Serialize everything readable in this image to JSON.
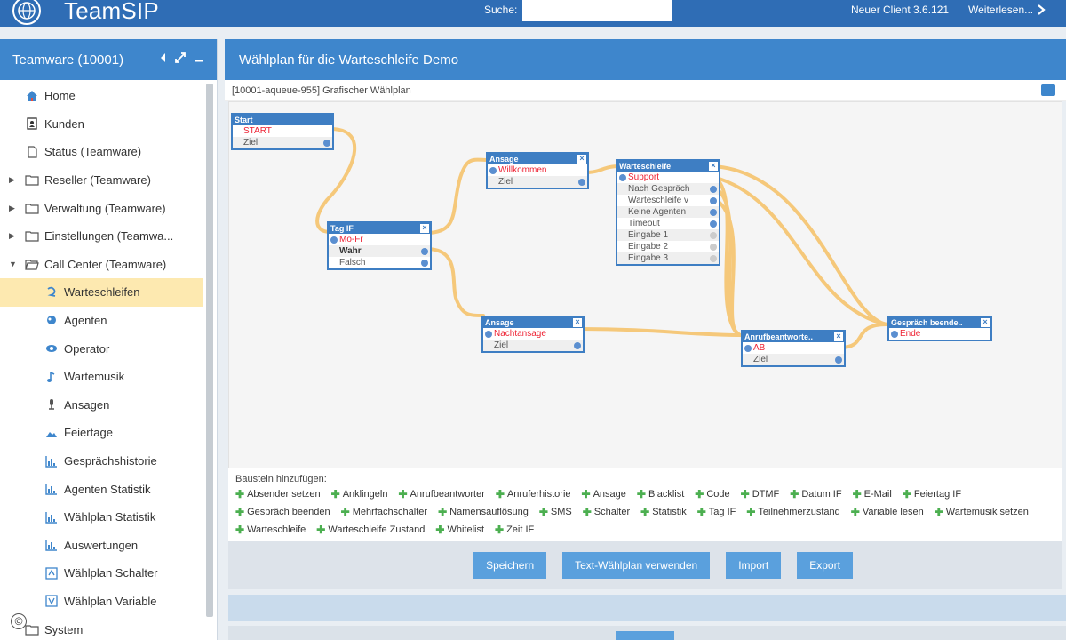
{
  "app": {
    "name": "TeamSIP",
    "search_label": "Suche:",
    "search_value": "",
    "client_version": "Neuer Client 3.6.121",
    "read_more": "Weiterlesen..."
  },
  "sidebar": {
    "title": "Teamware (10001)",
    "items": [
      {
        "label": "Home",
        "icon": "home-icon"
      },
      {
        "label": "Kunden",
        "icon": "contacts-icon"
      },
      {
        "label": "Status (Teamware)",
        "icon": "document-icon"
      },
      {
        "label": "Reseller (Teamware)",
        "icon": "folder-icon"
      },
      {
        "label": "Verwaltung (Teamware)",
        "icon": "folder-icon"
      },
      {
        "label": "Einstellungen (Teamwa...",
        "icon": "folder-icon"
      },
      {
        "label": "Call Center (Teamware)",
        "icon": "folder-open-icon"
      },
      {
        "label": "Warteschleifen",
        "icon": "queue-icon"
      },
      {
        "label": "Agenten",
        "icon": "agent-icon"
      },
      {
        "label": "Operator",
        "icon": "operator-icon"
      },
      {
        "label": "Wartemusik",
        "icon": "music-note-icon"
      },
      {
        "label": "Ansagen",
        "icon": "microphone-icon"
      },
      {
        "label": "Feiertage",
        "icon": "landscape-icon"
      },
      {
        "label": "Gesprächshistorie",
        "icon": "bar-chart-icon"
      },
      {
        "label": "Agenten Statistik",
        "icon": "bar-chart-icon"
      },
      {
        "label": "Wählplan Statistik",
        "icon": "bar-chart-icon"
      },
      {
        "label": "Auswertungen",
        "icon": "bar-chart-icon"
      },
      {
        "label": "Wählplan Schalter",
        "icon": "switch-icon"
      },
      {
        "label": "Wählplan Variable",
        "icon": "variable-icon"
      },
      {
        "label": "System",
        "icon": "folder-icon"
      }
    ]
  },
  "main": {
    "title": "Wählplan für die Warteschleife Demo",
    "subtitle": "[10001-aqueue-955] Grafischer Wählplan"
  },
  "nodes": {
    "start": {
      "title": "Start",
      "rows": [
        "START",
        "Ziel"
      ]
    },
    "tagif": {
      "title": "Tag IF",
      "rows": [
        "Mo-Fr",
        "Wahr",
        "Falsch"
      ]
    },
    "ansage1": {
      "title": "Ansage",
      "rows": [
        "Willkommen",
        "Ziel"
      ]
    },
    "ansage2": {
      "title": "Ansage",
      "rows": [
        "Nachtansage",
        "Ziel"
      ]
    },
    "warteschleife": {
      "title": "Warteschleife",
      "rows": [
        "Support",
        "Nach Gespräch",
        "Warteschleife v",
        "Keine Agenten",
        "Timeout",
        "Eingabe 1",
        "Eingabe 2",
        "Eingabe 3"
      ]
    },
    "anrufbeantworter": {
      "title": "Anrufbeantworte..",
      "rows": [
        "AB",
        "Ziel"
      ]
    },
    "gespraech": {
      "title": "Gespräch beende..",
      "rows": [
        "Ende"
      ]
    }
  },
  "palette": {
    "title": "Baustein hinzufügen:",
    "items": [
      "Absender setzen",
      "Anklingeln",
      "Anrufbeantworter",
      "Anruferhistorie",
      "Ansage",
      "Blacklist",
      "Code",
      "DTMF",
      "Datum IF",
      "E-Mail",
      "Feiertag IF",
      "Gespräch beenden",
      "Mehrfachschalter",
      "Namensauflösung",
      "SMS",
      "Schalter",
      "Statistik",
      "Tag IF",
      "Teilnehmerzustand",
      "Variable lesen",
      "Wartemusik setzen",
      "Warteschleife",
      "Warteschleife Zustand",
      "Whitelist",
      "Zeit IF"
    ]
  },
  "actions": {
    "save": "Speichern",
    "text_plan": "Text-Wählplan verwenden",
    "import": "Import",
    "export": "Export"
  },
  "footer": {
    "copyright": "©"
  },
  "colors": {
    "brand": "#2f6db5",
    "panel_header": "#3e86cc",
    "wire": "#f5c87a",
    "active": "#fde9b0",
    "button": "#5aa0dd"
  }
}
